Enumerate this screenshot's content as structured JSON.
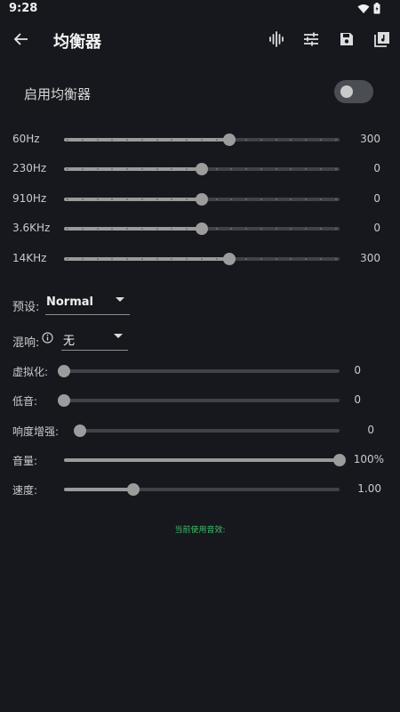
{
  "status": {
    "time": "9:28"
  },
  "app_bar": {
    "title": "均衡器",
    "icons": [
      "back-arrow-icon",
      "waveform-icon",
      "tune-sliders-icon",
      "save-icon",
      "library-music-icon"
    ]
  },
  "enable": {
    "label": "启用均衡器",
    "on": false
  },
  "bands": [
    {
      "label": "60Hz",
      "value": "300",
      "position": 0.6
    },
    {
      "label": "230Hz",
      "value": "0",
      "position": 0.5
    },
    {
      "label": "910Hz",
      "value": "0",
      "position": 0.5
    },
    {
      "label": "3.6KHz",
      "value": "0",
      "position": 0.5
    },
    {
      "label": "14KHz",
      "value": "300",
      "position": 0.6
    }
  ],
  "preset": {
    "label": "预设:",
    "value": "Normal"
  },
  "reverb": {
    "label": "混响:",
    "value": "无"
  },
  "effects": [
    {
      "label": "虚拟化:",
      "value": "0",
      "position": 0.0
    },
    {
      "label": "低音:",
      "value": "0",
      "position": 0.0
    },
    {
      "label": "响度增强:",
      "value": "0",
      "position": 0.0
    },
    {
      "label": "音量:",
      "value": "100%",
      "position": 1.0
    },
    {
      "label": "速度:",
      "value": "1.00",
      "position": 0.25
    }
  ],
  "footer": {
    "text": "当前使用音效:"
  },
  "colors": {
    "background": "#16181d",
    "footer_green": "#3fbf68"
  }
}
